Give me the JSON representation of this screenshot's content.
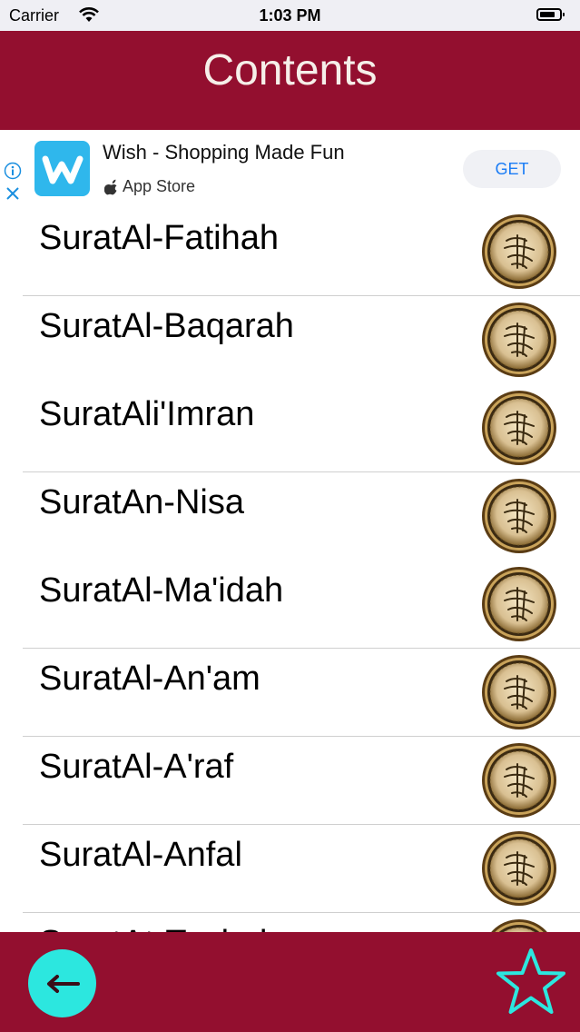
{
  "status_bar": {
    "carrier": "Carrier",
    "time": "1:03 PM",
    "icons": [
      "wifi-icon",
      "battery-icon"
    ]
  },
  "nav_bar": {
    "title": "Contents",
    "color": "#930f2f"
  },
  "ad": {
    "app_name": "Wish - Shopping Made Fun",
    "store_label": "App Store",
    "button_label": "GET",
    "icons": [
      "info-icon",
      "close-icon",
      "wish-app-icon",
      "apple-icon"
    ]
  },
  "list": {
    "items": [
      {
        "label": "SuratAl-Fatihah"
      },
      {
        "label": "SuratAl-Baqarah"
      },
      {
        "label": "SuratAli'Imran"
      },
      {
        "label": "SuratAn-Nisa"
      },
      {
        "label": "SuratAl-Ma'idah"
      },
      {
        "label": "SuratAl-An'am"
      },
      {
        "label": "SuratAl-A'raf"
      },
      {
        "label": "SuratAl-Anfal"
      },
      {
        "label": "SuratAt-Taubah"
      }
    ],
    "item_icon": "quran-medallion-icon"
  },
  "bottom_bar": {
    "back_icon": "arrow-left-icon",
    "favorite_icon": "star-icon",
    "accent": "#2ce7df"
  }
}
